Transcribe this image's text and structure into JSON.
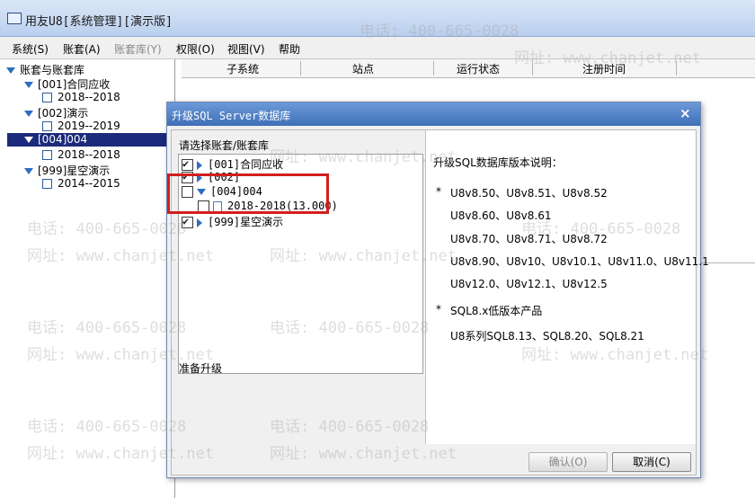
{
  "window": {
    "title": "用友U8[系统管理][演示版]"
  },
  "menu": [
    {
      "label": "系统(S)",
      "enabled": true
    },
    {
      "label": "账套(A)",
      "enabled": true
    },
    {
      "label": "账套库(Y)",
      "enabled": false
    },
    {
      "label": "权限(O)",
      "enabled": true
    },
    {
      "label": "视图(V)",
      "enabled": true
    },
    {
      "label": "帮助",
      "enabled": true
    }
  ],
  "tree": {
    "root": "账套与账套库",
    "nodes": [
      {
        "label": "[001]合同应收",
        "child": "2018--2018"
      },
      {
        "label": "[002]演示",
        "child": "2019--2019"
      },
      {
        "label": "[004]004",
        "child": "2018--2018"
      },
      {
        "label": "[999]星空演示",
        "child": "2014--2015"
      }
    ]
  },
  "grid_columns": [
    "子系统",
    "站点",
    "运行状态",
    "注册时间"
  ],
  "dialog": {
    "title": "升级SQL Server数据库",
    "close_symbol": "×",
    "select_label": "请选择账套/账套库",
    "items": [
      {
        "label": "[001]合同应收",
        "checked": true
      },
      {
        "label": "[002]",
        "checked": true
      },
      {
        "label": "[004]004",
        "checked": false
      },
      {
        "label": "2018-2018(13.000)",
        "checked": false
      },
      {
        "label": "[999]星空演示",
        "checked": true
      }
    ],
    "info_title": "升级SQL数据库版本说明：",
    "info_bullet": "*",
    "versions": [
      "U8v8.50、U8v8.51、U8v8.52",
      "U8v8.60、U8v8.61",
      "U8v8.70、U8v8.71、U8v8.72",
      "U8v8.90、U8v10、U8v10.1、U8v11.0、U8v11.1",
      "U8v12.0、U8v12.1、U8v12.5"
    ],
    "sql_title": "SQL8.x低版本产品",
    "sql_versions": "U8系列SQL8.13、SQL8.20、SQL8.21",
    "status": "准备升级",
    "confirm_label": "确认(O)",
    "cancel_label": "取消(C)"
  },
  "watermarks": {
    "phone": "电话: 400-665-0028",
    "site": "网址: www.chanjet.net"
  },
  "colors": {
    "highlight": "#d21f1f",
    "selection": "#1b2a7a",
    "titlebar": "#3f6fb7"
  }
}
